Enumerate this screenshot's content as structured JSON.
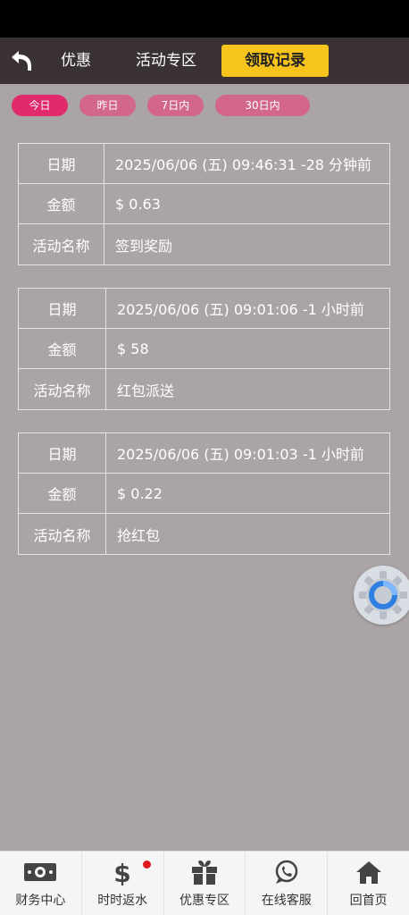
{
  "header": {
    "tabs": [
      {
        "label": "优惠"
      },
      {
        "label": "活动专区"
      },
      {
        "label": "领取记录"
      }
    ]
  },
  "filters": [
    "今日",
    "昨日",
    "7日内",
    "30日内"
  ],
  "labels": {
    "date": "日期",
    "amount": "金额",
    "activity": "活动名称"
  },
  "records": [
    {
      "date": "2025/06/06 (五) 09:46:31 -28 分钟前",
      "amount": "$ 0.63",
      "activity": "签到奖励"
    },
    {
      "date": "2025/06/06 (五) 09:01:06 -1 小时前",
      "amount": "$ 58",
      "activity": "红包派送"
    },
    {
      "date": "2025/06/06 (五) 09:01:03 -1 小时前",
      "amount": "$ 0.22",
      "activity": "抢红包"
    }
  ],
  "bottom_nav": [
    {
      "label": "财务中心",
      "icon": "money-icon"
    },
    {
      "label": "时时返水",
      "icon": "dollar-icon"
    },
    {
      "label": "优惠专区",
      "icon": "gift-icon"
    },
    {
      "label": "在线客服",
      "icon": "chat-icon"
    },
    {
      "label": "回首页",
      "icon": "home-icon"
    }
  ],
  "colors": {
    "background": "#aba4a6",
    "active_tab": "#f7c31d",
    "filter_active": "#e02a6c",
    "filter_inactive": "#d3668d"
  }
}
